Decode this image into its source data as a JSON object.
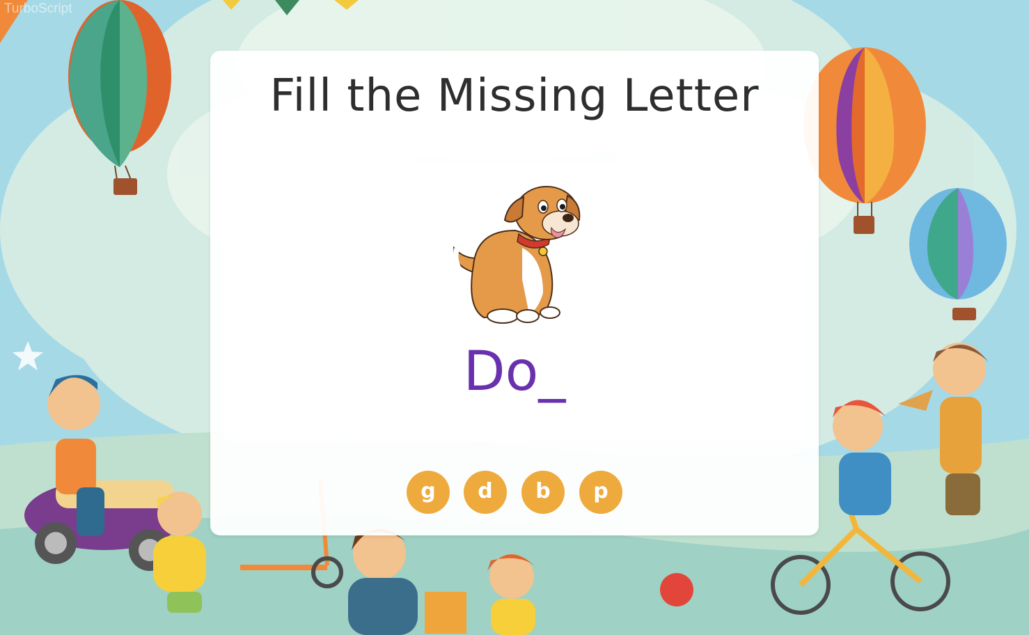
{
  "game": {
    "title": "Fill the Missing Letter",
    "word": "Do_",
    "options": [
      "g",
      "d",
      "b",
      "p"
    ]
  },
  "watermark": "TurboScript",
  "illustration": "dog-image",
  "colors": {
    "sky": "#a6d9e6",
    "title_text": "#2e2e2e",
    "word_text": "#6a31ae",
    "option_button": "#eeaa3c",
    "card": "#ffffff"
  }
}
